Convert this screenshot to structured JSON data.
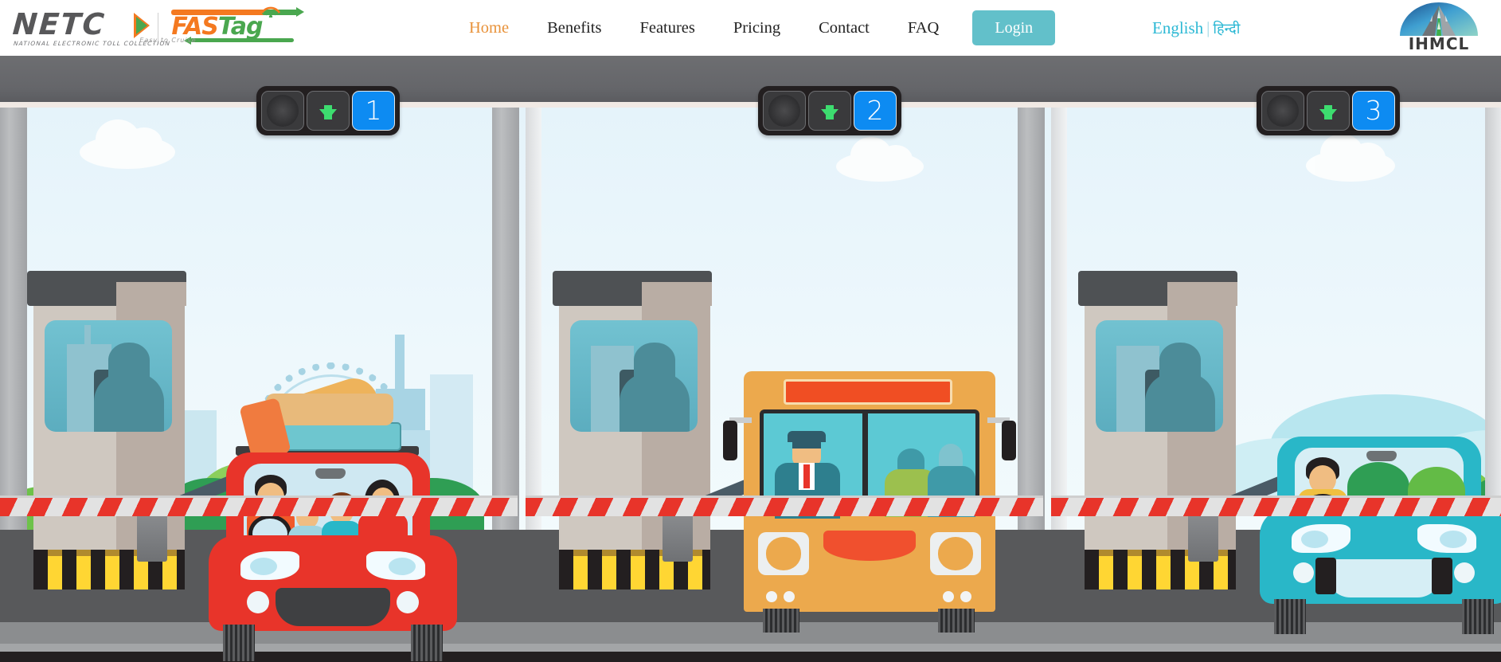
{
  "header": {
    "brand": {
      "netc_word": "NETC",
      "netc_tagline": "NATIONAL ELECTRONIC TOLL COLLECTION",
      "fastag_word_1": "FAS",
      "fastag_word_2": "Tag",
      "fastag_tagline": "Easy to Cruise"
    },
    "nav": [
      {
        "label": "Home",
        "active": true
      },
      {
        "label": "Benefits",
        "active": false
      },
      {
        "label": "Features",
        "active": false
      },
      {
        "label": "Pricing",
        "active": false
      },
      {
        "label": "Contact",
        "active": false
      },
      {
        "label": "FAQ",
        "active": false
      }
    ],
    "login_label": "Login",
    "language": {
      "english": "English",
      "separator": "|",
      "hindi": "हिन्दी"
    },
    "partner_logo": {
      "text": "IHMCL"
    }
  },
  "hero": {
    "alt": "Toll plaza illustration with three lanes",
    "lanes": [
      {
        "number": "1",
        "arrow": "down-arrow-green",
        "lamp": "lamp-off",
        "vehicle": "red-car"
      },
      {
        "number": "2",
        "arrow": "down-arrow-green",
        "lamp": "lamp-off",
        "vehicle": "orange-bus"
      },
      {
        "number": "3",
        "arrow": "down-arrow-green",
        "lamp": "lamp-off",
        "vehicle": "teal-car"
      }
    ]
  },
  "colors": {
    "accent_orange": "#e8923a",
    "brand_orange": "#f47920",
    "brand_green": "#4aa74f",
    "login_teal": "#62c0ca",
    "language_teal": "#2bb8d4",
    "lane_blue": "#0d8bf2",
    "arrow_green": "#3ddc6f",
    "car_red": "#e8342a",
    "bus_orange": "#eca94d",
    "car_teal": "#29b7c8",
    "canopy_gray": "#6d6e71",
    "road_gray": "#58595b",
    "sky_blue": "#e3f2fa"
  }
}
